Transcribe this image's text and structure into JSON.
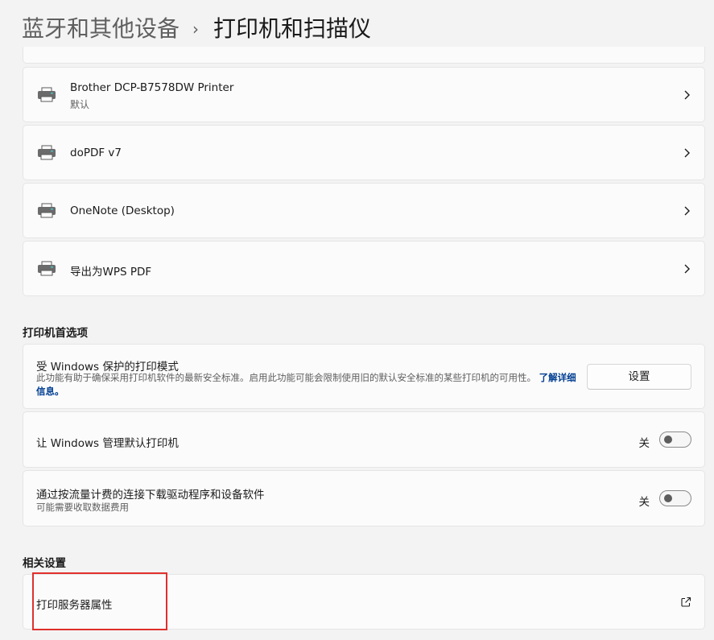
{
  "breadcrumb": {
    "parent": "蓝牙和其他设备",
    "separator": "›",
    "current": "打印机和扫描仪"
  },
  "printers": [
    {
      "name": "Brother DCP-B7578DW Printer",
      "subtitle": "默认",
      "icon": "printer-icon"
    },
    {
      "name": "doPDF v7",
      "icon": "printer-icon"
    },
    {
      "name": "OneNote (Desktop)",
      "icon": "printer-icon"
    },
    {
      "name": "导出为WPS PDF",
      "icon": "printer-icon"
    }
  ],
  "preferences": {
    "heading": "打印机首选项",
    "protected_mode": {
      "title": "受 Windows 保护的打印模式",
      "desc": "此功能有助于确保采用打印机软件的最新安全标准。启用此功能可能会限制使用旧的默认安全标准的某些打印机的可用性。",
      "link": "了解详细信息。",
      "button": "设置"
    },
    "manage_default": {
      "title": "让 Windows 管理默认打印机",
      "state_label": "关",
      "on": false
    },
    "metered": {
      "title": "通过按流量计费的连接下载驱动程序和设备软件",
      "desc": "可能需要收取数据费用",
      "state_label": "关",
      "on": false
    }
  },
  "related": {
    "heading": "相关设置",
    "print_server": {
      "title": "打印服务器属性",
      "icon": "open-external-icon"
    }
  },
  "colors": {
    "background": "#f3f3f3",
    "card": "#fbfbfb",
    "link": "#003e92",
    "highlight": "#e0302c"
  }
}
